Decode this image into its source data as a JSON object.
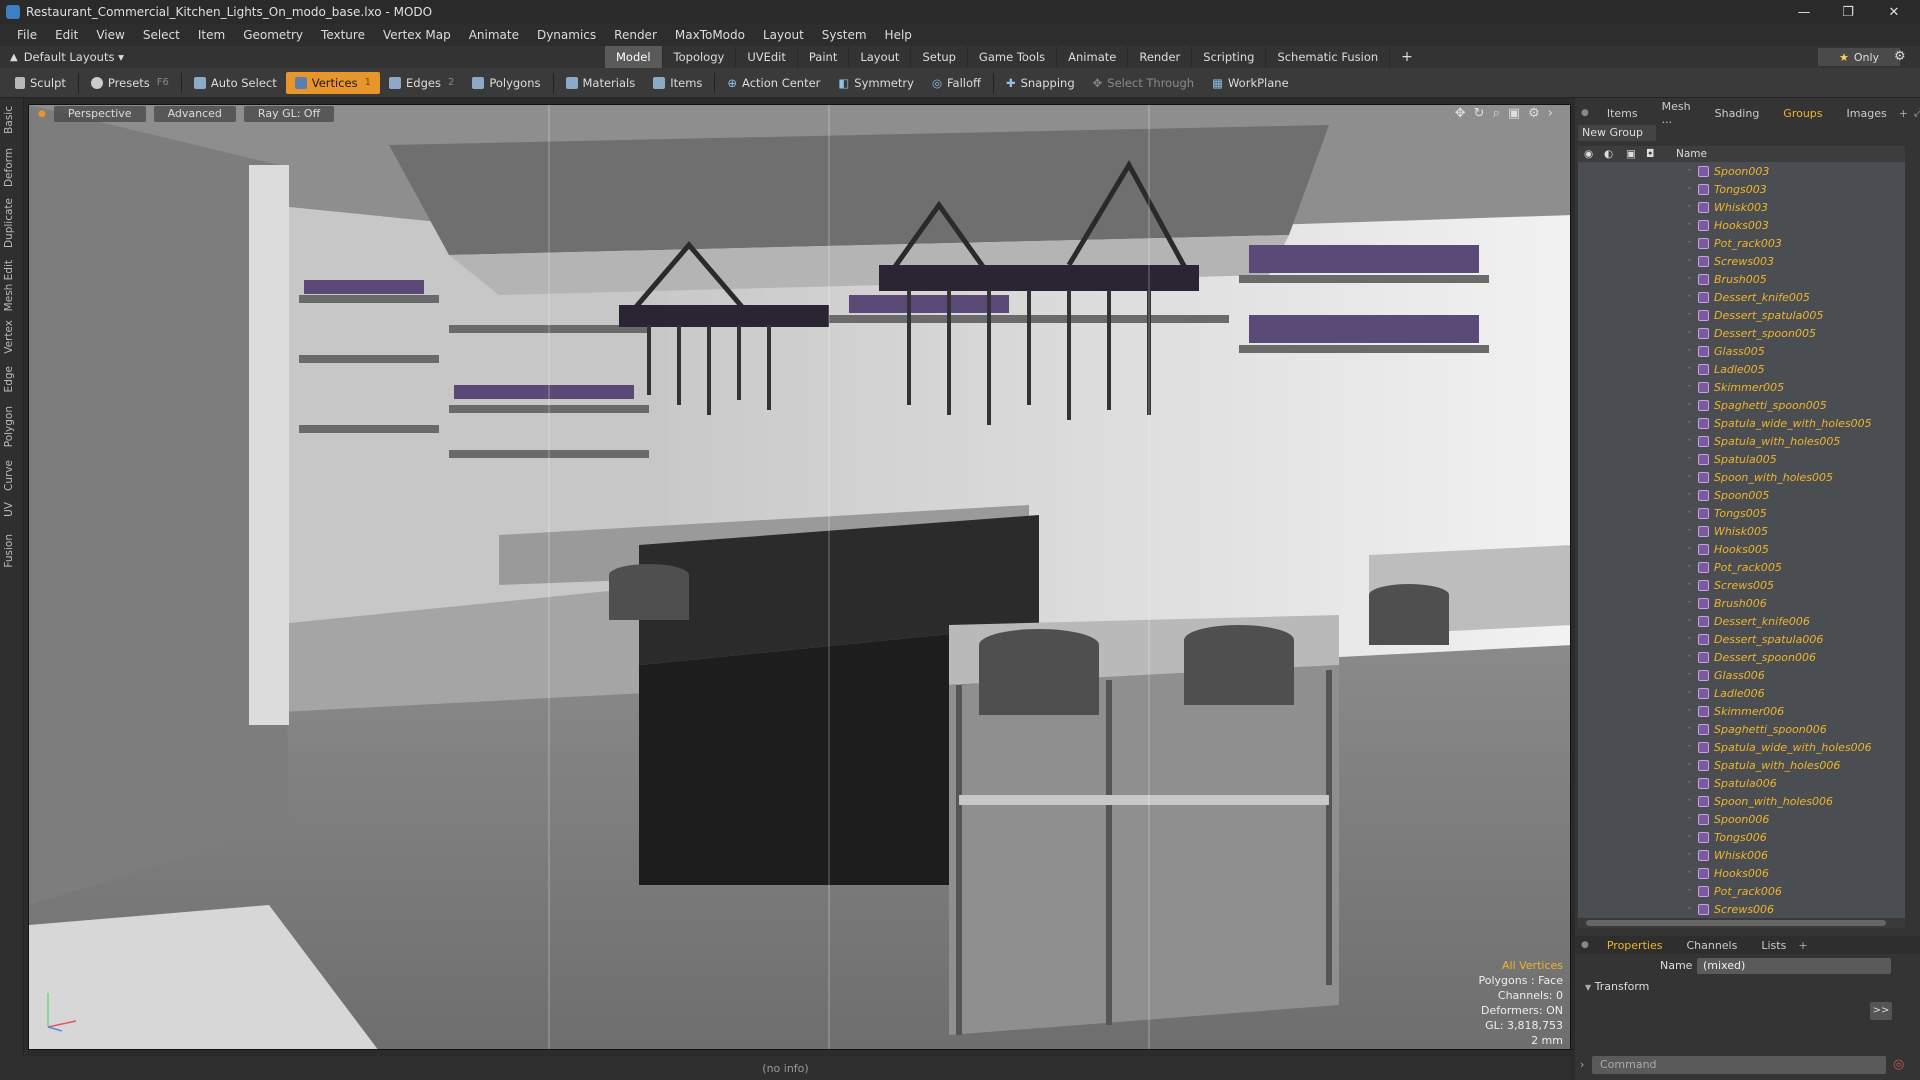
{
  "window": {
    "title": "Restaurant_Commercial_Kitchen_Lights_On_modo_base.lxo - MODO",
    "minimize": "—",
    "maximize": "❐",
    "close": "✕"
  },
  "menu": [
    "File",
    "Edit",
    "View",
    "Select",
    "Item",
    "Geometry",
    "Texture",
    "Vertex Map",
    "Animate",
    "Dynamics",
    "Render",
    "MaxToModo",
    "Layout",
    "System",
    "Help"
  ],
  "layout_bar": {
    "layouts_label": "Default Layouts ▾",
    "tabs": [
      "Model",
      "Topology",
      "UVEdit",
      "Paint",
      "Layout",
      "Setup",
      "Game Tools",
      "Animate",
      "Render",
      "Scripting",
      "Schematic Fusion"
    ],
    "active_tab": "Model",
    "add_tab": "+",
    "only_label": "Only"
  },
  "toolbar": {
    "sculpt": "Sculpt",
    "presets": "Presets",
    "presets_key": "F6",
    "auto_select": "Auto Select",
    "vertices": "Vertices",
    "vertices_key": "1",
    "edges": "Edges",
    "edges_key": "2",
    "polygons": "Polygons",
    "materials": "Materials",
    "items": "Items",
    "action_center": "Action Center",
    "symmetry": "Symmetry",
    "falloff": "Falloff",
    "snapping": "Snapping",
    "select_through": "Select Through",
    "workplane": "WorkPlane"
  },
  "left_tabs": [
    "Basic",
    "Deform",
    "Duplicate",
    "Mesh Edit",
    "Vertex",
    "Edge",
    "Polygon",
    "Curve",
    "UV",
    "Fusion"
  ],
  "viewport": {
    "view_mode": "Perspective",
    "advanced": "Advanced",
    "raygl": "Ray GL: Off",
    "stats": {
      "selection": "All Vertices",
      "polygons": "Polygons : Face",
      "channels": "Channels: 0",
      "deformers": "Deformers: ON",
      "gl": "GL: 3,818,753",
      "scale": "2 mm"
    }
  },
  "status": "(no info)",
  "right_panel": {
    "tabs": [
      "Items",
      "Mesh ...",
      "Shading",
      "Groups",
      "Images"
    ],
    "active_tab": "Groups",
    "new_group": "New Group",
    "column_name": "Name",
    "groups": [
      "Spoon003",
      "Tongs003",
      "Whisk003",
      "Hooks003",
      "Pot_rack003",
      "Screws003",
      "Brush005",
      "Dessert_knife005",
      "Dessert_spatula005",
      "Dessert_spoon005",
      "Glass005",
      "Ladle005",
      "Skimmer005",
      "Spaghetti_spoon005",
      "Spatula_wide_with_holes005",
      "Spatula_with_holes005",
      "Spatula005",
      "Spoon_with_holes005",
      "Spoon005",
      "Tongs005",
      "Whisk005",
      "Hooks005",
      "Pot_rack005",
      "Screws005",
      "Brush006",
      "Dessert_knife006",
      "Dessert_spatula006",
      "Dessert_spoon006",
      "Glass006",
      "Ladle006",
      "Skimmer006",
      "Spaghetti_spoon006",
      "Spatula_wide_with_holes006",
      "Spatula_with_holes006",
      "Spatula006",
      "Spoon_with_holes006",
      "Spoon006",
      "Tongs006",
      "Whisk006",
      "Hooks006",
      "Pot_rack006",
      "Screws006"
    ],
    "properties": {
      "tabs": [
        "Properties",
        "Channels",
        "Lists"
      ],
      "active_tab": "Properties",
      "name_label": "Name",
      "name_value": "(mixed)",
      "transform": "Transform",
      "expand": ">>"
    },
    "command_placeholder": "Command"
  },
  "colors": {
    "accent": "#e8952c",
    "group_label": "#f0b429",
    "viewport_bg": "#9e9e9e"
  }
}
